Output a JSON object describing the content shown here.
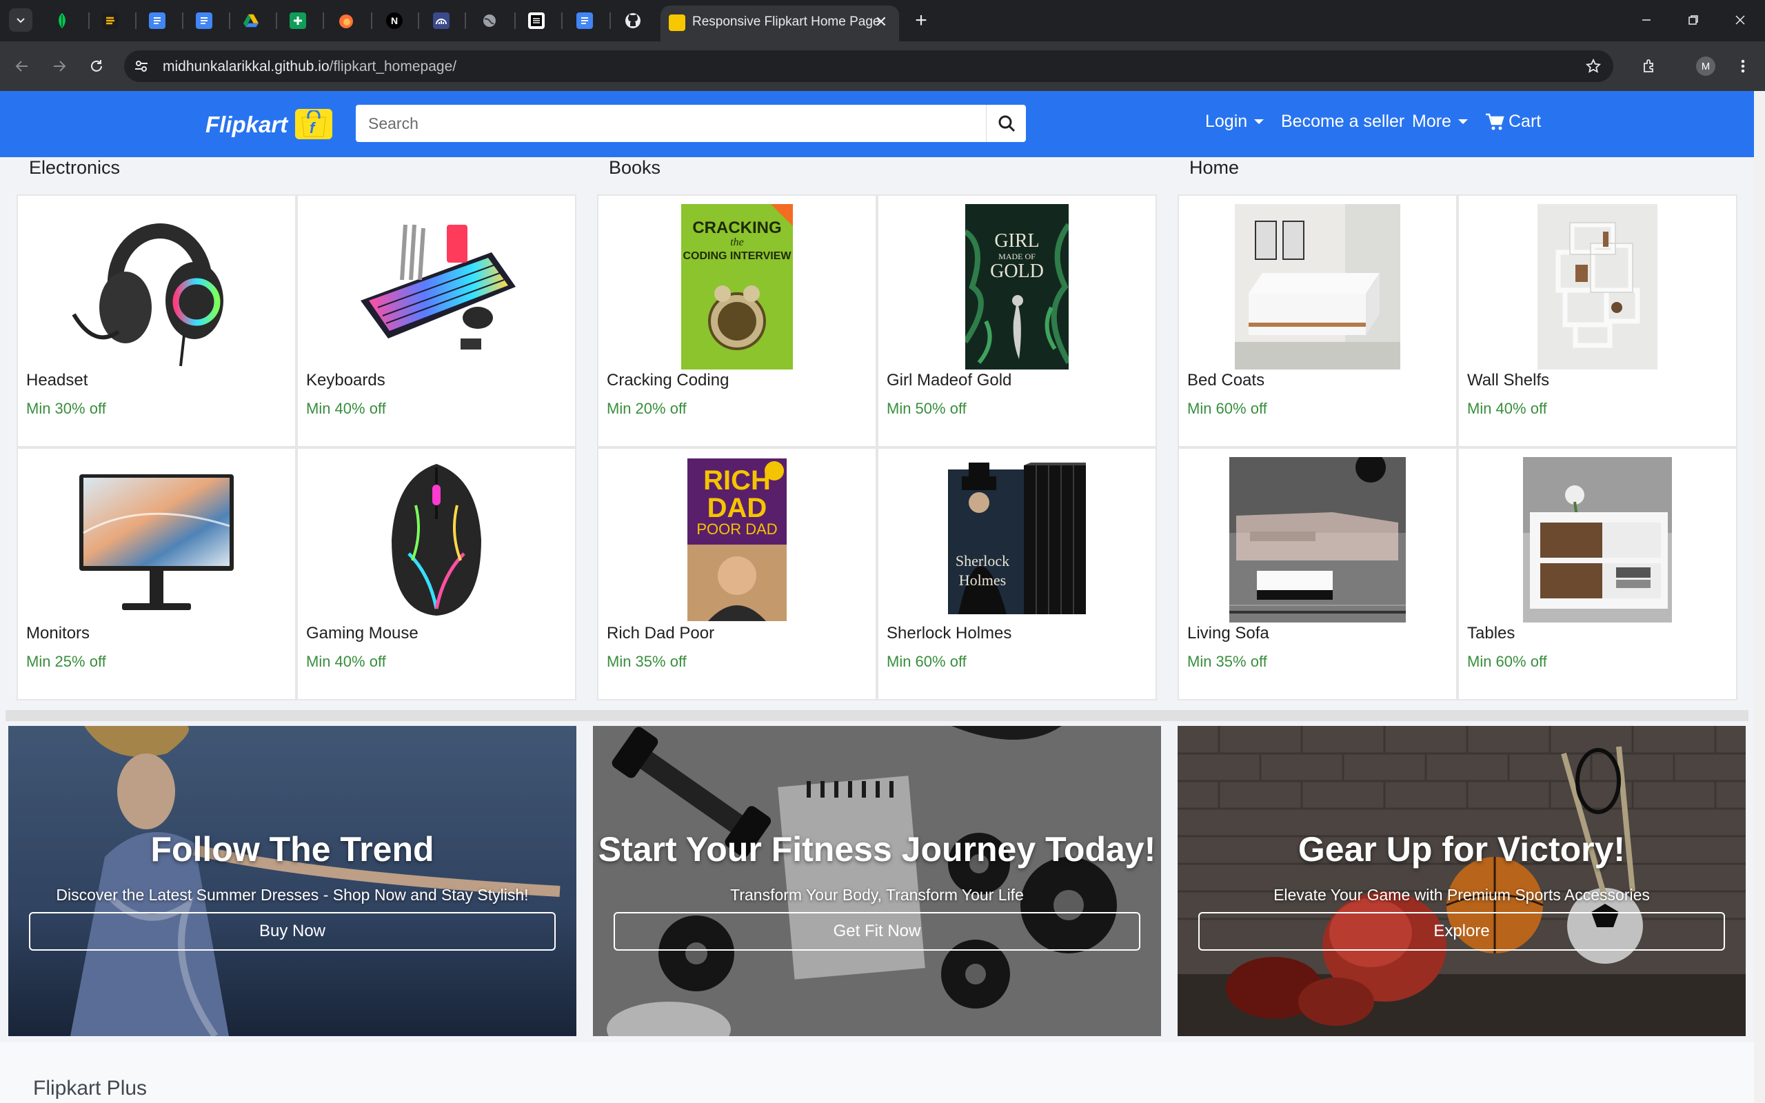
{
  "browser": {
    "active_tab_title": "Responsive Flipkart Home Page",
    "url_host": "midhunkalarikkal.github.io",
    "url_path": "/flipkart_homepage/",
    "profile_initial": "M"
  },
  "header": {
    "logo": "Flipkart",
    "search_placeholder": "Search",
    "login": "Login",
    "seller": "Become a seller",
    "more": "More",
    "cart": "Cart"
  },
  "categories": [
    {
      "title": "Electronics",
      "items": [
        {
          "name": "Headset",
          "offer": "Min 30% off"
        },
        {
          "name": "Keyboards",
          "offer": "Min 40% off"
        },
        {
          "name": "Monitors",
          "offer": "Min 25% off"
        },
        {
          "name": "Gaming Mouse",
          "offer": "Min 40% off"
        }
      ]
    },
    {
      "title": "Books",
      "items": [
        {
          "name": "Cracking Coding",
          "offer": "Min 20% off"
        },
        {
          "name": "Girl Madeof Gold",
          "offer": "Min 50% off"
        },
        {
          "name": "Rich Dad Poor",
          "offer": "Min 35% off"
        },
        {
          "name": "Sherlock Holmes",
          "offer": "Min 60% off"
        }
      ]
    },
    {
      "title": "Home",
      "items": [
        {
          "name": "Bed Coats",
          "offer": "Min 60% off"
        },
        {
          "name": "Wall Shelfs",
          "offer": "Min 40% off"
        },
        {
          "name": "Living Sofa",
          "offer": "Min 35% off"
        },
        {
          "name": "Tables",
          "offer": "Min 60% off"
        }
      ]
    }
  ],
  "book_covers": {
    "cracking": [
      "CRACKING",
      "the",
      "CODING INTERVIEW"
    ],
    "girl": [
      "GIRL",
      "MADE OF",
      "GOLD"
    ],
    "rich": [
      "RICH",
      "DAD",
      "POOR DAD"
    ],
    "sherlock": [
      "Sherlock",
      "Holmes"
    ]
  },
  "banners": [
    {
      "title": "Follow The Trend",
      "subtitle": "Discover the Latest Summer Dresses - Shop Now and Stay Stylish!",
      "button": "Buy Now"
    },
    {
      "title": "Start Your Fitness Journey Today!",
      "subtitle": "Transform Your Body, Transform Your Life",
      "button": "Get Fit Now"
    },
    {
      "title": "Gear Up for Victory!",
      "subtitle": "Elevate Your Game with Premium Sports Accessories",
      "button": "Explore"
    }
  ],
  "footer_section": {
    "title": "Flipkart Plus"
  },
  "colors": {
    "brand_blue": "#2874f0",
    "offer_green": "#388e3c",
    "logo_yellow": "#ffe11b"
  }
}
